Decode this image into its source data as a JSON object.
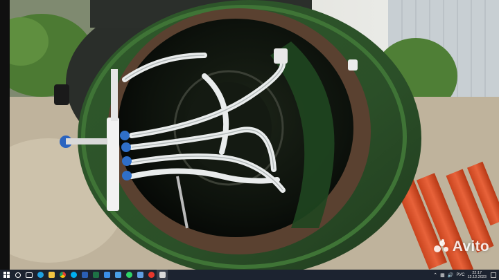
{
  "photo": {
    "watermark": "Avito"
  },
  "taskbar": {
    "apps": [
      {
        "name": "start-button",
        "color": "#ffffff"
      },
      {
        "name": "search-icon",
        "color": "#ffffff"
      },
      {
        "name": "task-view-icon",
        "color": "#ffffff"
      },
      {
        "name": "edge-icon",
        "color": "#1fa0e0"
      },
      {
        "name": "file-explorer-icon",
        "color": "#f3c341"
      },
      {
        "name": "chrome-icon",
        "color": "#e34133"
      },
      {
        "name": "skype-icon",
        "color": "#00aff0"
      },
      {
        "name": "word-icon",
        "color": "#2b5fb4"
      },
      {
        "name": "excel-icon",
        "color": "#1e7145"
      },
      {
        "name": "store-icon",
        "color": "#3a8ee6"
      },
      {
        "name": "mail-icon",
        "color": "#4aa0e6"
      },
      {
        "name": "whatsapp-icon",
        "color": "#2fd366"
      },
      {
        "name": "photos-icon",
        "color": "#5f9de0"
      },
      {
        "name": "yandex-icon",
        "color": "#e8382d"
      },
      {
        "name": "media-player-icon",
        "color": "#d8d8d8"
      }
    ],
    "tray": {
      "language": "РУС",
      "time": "22:17",
      "date": "12.12.2023"
    }
  }
}
